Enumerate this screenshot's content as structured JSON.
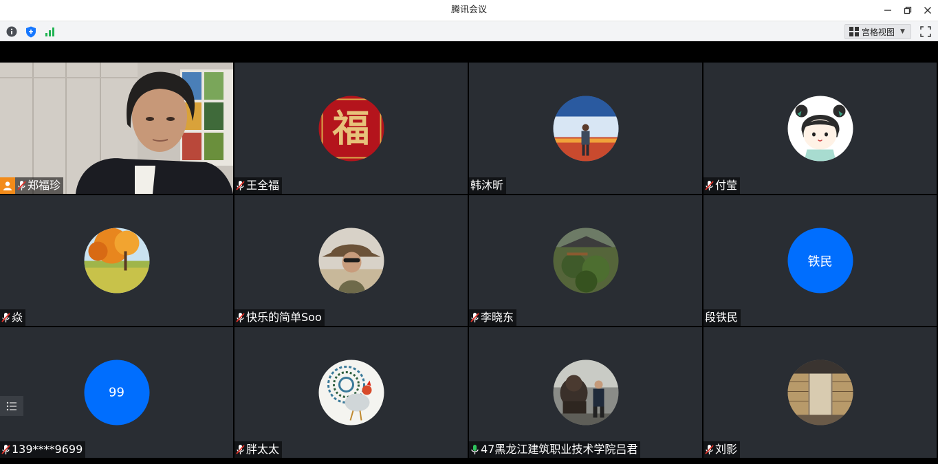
{
  "window": {
    "title": "腾讯会议"
  },
  "toolbar": {
    "info_icon": "info-icon",
    "security_icon": "shield-icon",
    "signal_icon": "signal-bars-icon",
    "view_mode_label": "宫格视图"
  },
  "participants": [
    {
      "name": "郑福珍",
      "host": true,
      "mic": "muted",
      "avatar_type": "video"
    },
    {
      "name": "王全福",
      "mic": "muted",
      "avatar_type": "image",
      "avatar_desc": "fu-character"
    },
    {
      "name": "韩沐昕",
      "mic": "none",
      "avatar_type": "image",
      "avatar_desc": "conference-photo"
    },
    {
      "name": "付莹",
      "mic": "muted",
      "avatar_type": "image",
      "avatar_desc": "cartoon-girl"
    },
    {
      "name": "焱",
      "mic": "muted",
      "avatar_type": "image",
      "avatar_desc": "autumn-tree"
    },
    {
      "name": "快乐的简单Soo",
      "mic": "muted",
      "avatar_type": "image",
      "avatar_desc": "cowboy-hat-photo"
    },
    {
      "name": "李晓东",
      "mic": "muted",
      "avatar_type": "image",
      "avatar_desc": "garden-photo"
    },
    {
      "name": "段铁民",
      "mic": "none",
      "avatar_type": "text",
      "avatar_text": "铁民"
    },
    {
      "name": "139****9699",
      "mic": "muted",
      "avatar_type": "text",
      "avatar_text": "99"
    },
    {
      "name": "胖太太",
      "mic": "muted",
      "avatar_type": "image",
      "avatar_desc": "rooster-art"
    },
    {
      "name": "47黑龙江建筑职业技术学院吕君",
      "mic": "active",
      "avatar_type": "image",
      "avatar_desc": "lion-statue-photo"
    },
    {
      "name": "刘影",
      "mic": "muted",
      "avatar_type": "image",
      "avatar_desc": "library-photo"
    }
  ],
  "colors": {
    "avatar_blue": "#006efe",
    "tile_bg": "#292d33",
    "host_orange": "#f28b1a",
    "mic_active": "#2fc45e"
  }
}
